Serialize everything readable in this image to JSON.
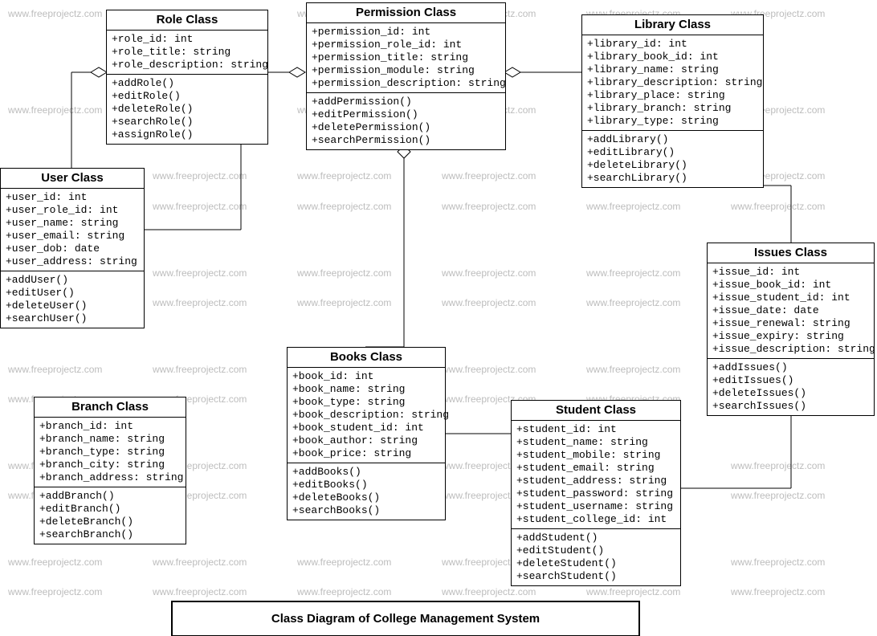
{
  "watermark_text": "www.freeprojectz.com",
  "diagram_title": "Class Diagram of College Management System",
  "classes": {
    "role": {
      "title": "Role Class",
      "attrs": [
        "+role_id: int",
        "+role_title: string",
        "+role_description: string"
      ],
      "ops": [
        "+addRole()",
        "+editRole()",
        "+deleteRole()",
        "+searchRole()",
        "+assignRole()"
      ]
    },
    "permission": {
      "title": "Permission Class",
      "attrs": [
        "+permission_id: int",
        "+permission_role_id: int",
        "+permission_title: string",
        "+permission_module: string",
        "+permission_description: string"
      ],
      "ops": [
        "+addPermission()",
        "+editPermission()",
        "+deletePermission()",
        "+searchPermission()"
      ]
    },
    "library": {
      "title": "Library Class",
      "attrs": [
        "+library_id: int",
        "+library_book_id: int",
        "+library_name: string",
        "+library_description: string",
        "+library_place: string",
        "+library_branch: string",
        "+library_type: string"
      ],
      "ops": [
        "+addLibrary()",
        "+editLibrary()",
        "+deleteLibrary()",
        "+searchLibrary()"
      ]
    },
    "user": {
      "title": "User Class",
      "attrs": [
        "+user_id: int",
        "+user_role_id: int",
        "+user_name: string",
        "+user_email: string",
        "+user_dob: date",
        "+user_address: string"
      ],
      "ops": [
        "+addUser()",
        "+editUser()",
        "+deleteUser()",
        "+searchUser()"
      ]
    },
    "issues": {
      "title": "Issues Class",
      "attrs": [
        "+issue_id: int",
        "+issue_book_id: int",
        "+issue_student_id: int",
        "+issue_date: date",
        "+issue_renewal: string",
        "+issue_expiry: string",
        "+issue_description: string"
      ],
      "ops": [
        "+addIssues()",
        "+editIssues()",
        "+deleteIssues()",
        "+searchIssues()"
      ]
    },
    "books": {
      "title": "Books Class",
      "attrs": [
        "+book_id: int",
        "+book_name: string",
        "+book_type: string",
        "+book_description: string",
        "+book_student_id: int",
        "+book_author: string",
        "+book_price: string"
      ],
      "ops": [
        "+addBooks()",
        "+editBooks()",
        "+deleteBooks()",
        "+searchBooks()"
      ]
    },
    "branch": {
      "title": "Branch Class",
      "attrs": [
        "+branch_id: int",
        "+branch_name: string",
        "+branch_type: string",
        "+branch_city: string",
        "+branch_address: string"
      ],
      "ops": [
        "+addBranch()",
        "+editBranch()",
        "+deleteBranch()",
        "+searchBranch()"
      ]
    },
    "student": {
      "title": "Student Class",
      "attrs": [
        "+student_id: int",
        "+student_name: string",
        "+student_mobile: string",
        "+student_email: string",
        "+student_address: string",
        "+student_password: string",
        "+student_username: string",
        "+student_college_id: int"
      ],
      "ops": [
        "+addStudent()",
        "+editStudent()",
        "+deleteStudent()",
        "+searchStudent()"
      ]
    }
  }
}
